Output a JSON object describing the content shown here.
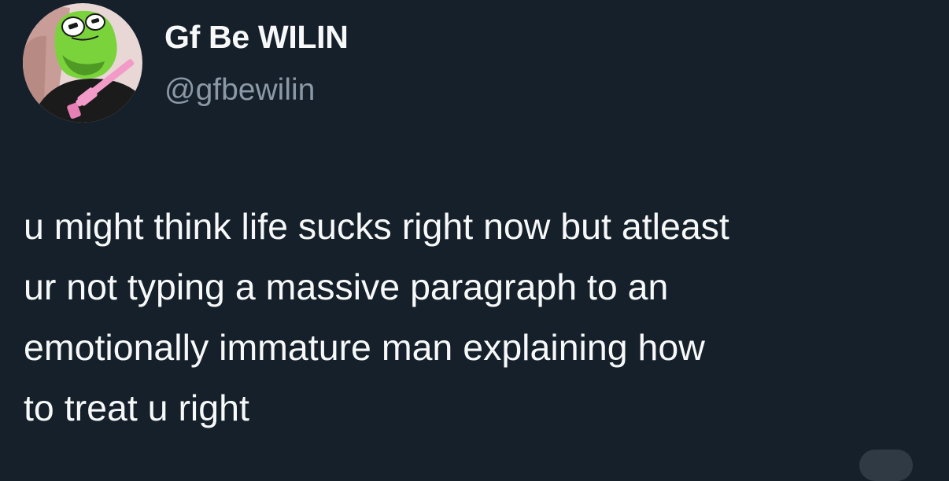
{
  "author": {
    "display_name": "Gf Be WILIN",
    "handle": "@gfbewilin",
    "avatar_icon": "avatar-kermit-frog-icon"
  },
  "tweet": {
    "lines": [
      "u might think life sucks right now but atleast",
      "ur not typing a massive paragraph to an",
      "emotionally immature man explaining how",
      "to treat u right"
    ]
  },
  "colors": {
    "background": "#15202b",
    "text_primary": "#f7f9f9",
    "text_secondary": "#8b98a5"
  }
}
